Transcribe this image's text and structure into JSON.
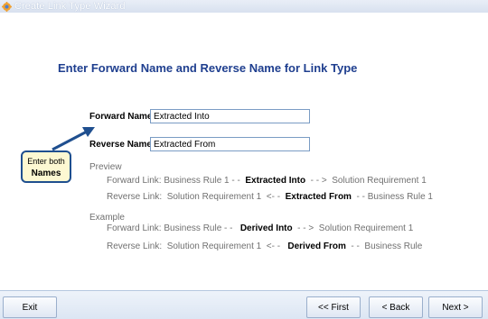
{
  "window": {
    "title": "Create Link Type Wizard"
  },
  "heading": "Enter Forward Name and Reverse Name for Link Type",
  "form": {
    "forward_label": "Forward Name:",
    "forward_value": "Extracted Into",
    "reverse_label": "Reverse Name:",
    "reverse_value": "Extracted From"
  },
  "callout": {
    "line1": "Enter both",
    "line2": "Names"
  },
  "preview": {
    "title": "Preview",
    "forward": {
      "prefix": "Forward Link: Business Rule 1 - -  ",
      "name": "Extracted Into",
      "suffix": "  - - >  Solution Requirement 1"
    },
    "reverse": {
      "prefix": "Reverse Link:  Solution Requirement 1  <- -  ",
      "name": "Extracted From",
      "suffix": "  - - Business Rule 1"
    }
  },
  "example": {
    "title": "Example",
    "forward": {
      "prefix": "Forward Link: Business Rule - -   ",
      "name": "Derived Into",
      "suffix": "  - - >  Solution Requirement 1"
    },
    "reverse": {
      "prefix": "Reverse Link:  Solution Requirement 1  <- -   ",
      "name": "Derived From",
      "suffix": "  - -  Business Rule"
    }
  },
  "buttons": {
    "exit": "Exit",
    "first": "<< First",
    "back": "< Back",
    "next": "Next >"
  },
  "colors": {
    "heading": "#1f3f8f",
    "callout_bg": "#fdf8d2",
    "callout_border": "#1f4f8f"
  },
  "icons": {
    "app": "gear-icon"
  }
}
